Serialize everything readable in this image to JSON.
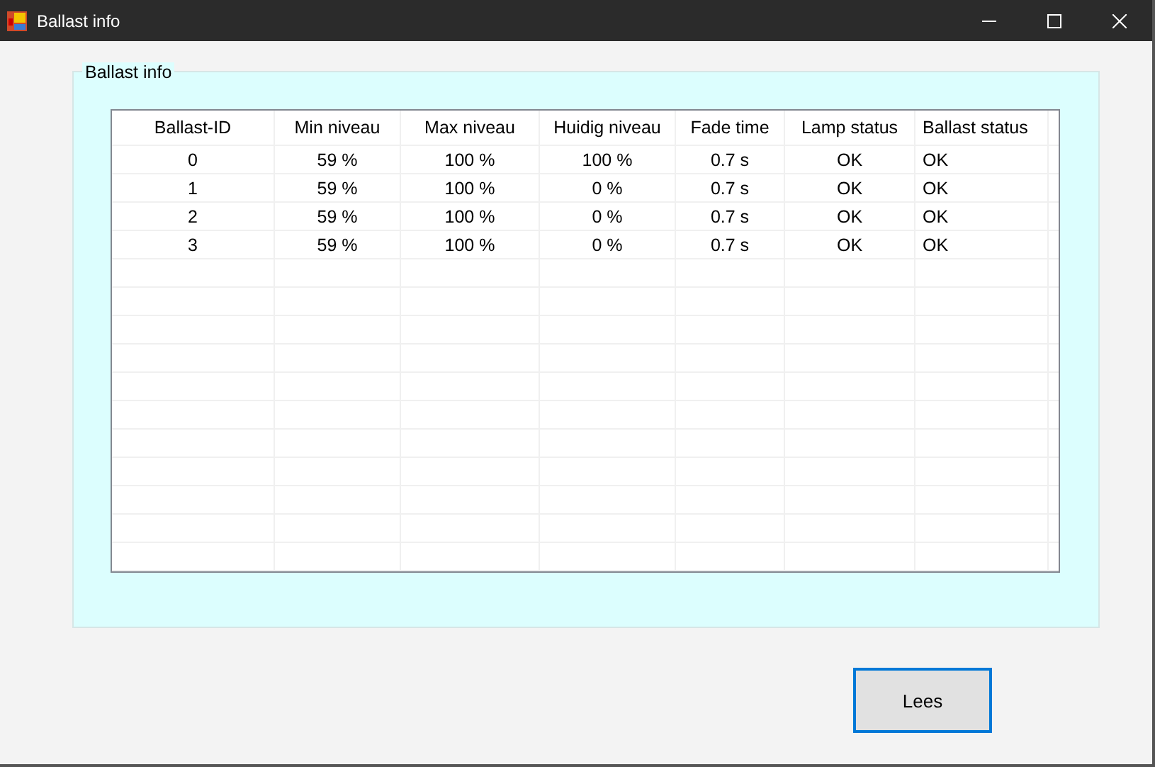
{
  "window": {
    "title": "Ballast info"
  },
  "group": {
    "title": "Ballast info"
  },
  "table": {
    "columns": [
      "Ballast-ID",
      "Min niveau",
      "Max niveau",
      "Huidig niveau",
      "Fade time",
      "Lamp status",
      "Ballast status"
    ],
    "rows": [
      [
        "0",
        "59 %",
        "100 %",
        "100 %",
        "0.7 s",
        "OK",
        "OK"
      ],
      [
        "1",
        "59 %",
        "100 %",
        "0 %",
        "0.7 s",
        "OK",
        "OK"
      ],
      [
        "2",
        "59 %",
        "100 %",
        "0 %",
        "0.7 s",
        "OK",
        "OK"
      ],
      [
        "3",
        "59 %",
        "100 %",
        "0 %",
        "0.7 s",
        "OK",
        "OK"
      ]
    ]
  },
  "buttons": [
    {
      "label": "Lees",
      "focused": true
    }
  ]
}
